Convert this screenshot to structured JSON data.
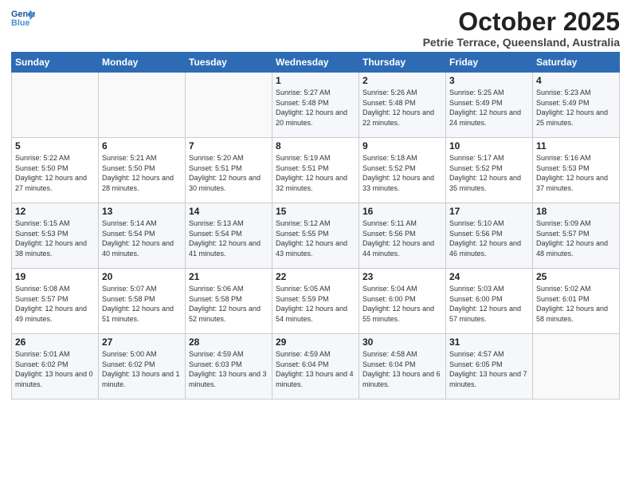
{
  "logo": {
    "line1": "General",
    "line2": "Blue"
  },
  "title": "October 2025",
  "subtitle": "Petrie Terrace, Queensland, Australia",
  "weekdays": [
    "Sunday",
    "Monday",
    "Tuesday",
    "Wednesday",
    "Thursday",
    "Friday",
    "Saturday"
  ],
  "weeks": [
    [
      {
        "day": "",
        "sunrise": "",
        "sunset": "",
        "daylight": ""
      },
      {
        "day": "",
        "sunrise": "",
        "sunset": "",
        "daylight": ""
      },
      {
        "day": "",
        "sunrise": "",
        "sunset": "",
        "daylight": ""
      },
      {
        "day": "1",
        "sunrise": "Sunrise: 5:27 AM",
        "sunset": "Sunset: 5:48 PM",
        "daylight": "Daylight: 12 hours and 20 minutes."
      },
      {
        "day": "2",
        "sunrise": "Sunrise: 5:26 AM",
        "sunset": "Sunset: 5:48 PM",
        "daylight": "Daylight: 12 hours and 22 minutes."
      },
      {
        "day": "3",
        "sunrise": "Sunrise: 5:25 AM",
        "sunset": "Sunset: 5:49 PM",
        "daylight": "Daylight: 12 hours and 24 minutes."
      },
      {
        "day": "4",
        "sunrise": "Sunrise: 5:23 AM",
        "sunset": "Sunset: 5:49 PM",
        "daylight": "Daylight: 12 hours and 25 minutes."
      }
    ],
    [
      {
        "day": "5",
        "sunrise": "Sunrise: 5:22 AM",
        "sunset": "Sunset: 5:50 PM",
        "daylight": "Daylight: 12 hours and 27 minutes."
      },
      {
        "day": "6",
        "sunrise": "Sunrise: 5:21 AM",
        "sunset": "Sunset: 5:50 PM",
        "daylight": "Daylight: 12 hours and 28 minutes."
      },
      {
        "day": "7",
        "sunrise": "Sunrise: 5:20 AM",
        "sunset": "Sunset: 5:51 PM",
        "daylight": "Daylight: 12 hours and 30 minutes."
      },
      {
        "day": "8",
        "sunrise": "Sunrise: 5:19 AM",
        "sunset": "Sunset: 5:51 PM",
        "daylight": "Daylight: 12 hours and 32 minutes."
      },
      {
        "day": "9",
        "sunrise": "Sunrise: 5:18 AM",
        "sunset": "Sunset: 5:52 PM",
        "daylight": "Daylight: 12 hours and 33 minutes."
      },
      {
        "day": "10",
        "sunrise": "Sunrise: 5:17 AM",
        "sunset": "Sunset: 5:52 PM",
        "daylight": "Daylight: 12 hours and 35 minutes."
      },
      {
        "day": "11",
        "sunrise": "Sunrise: 5:16 AM",
        "sunset": "Sunset: 5:53 PM",
        "daylight": "Daylight: 12 hours and 37 minutes."
      }
    ],
    [
      {
        "day": "12",
        "sunrise": "Sunrise: 5:15 AM",
        "sunset": "Sunset: 5:53 PM",
        "daylight": "Daylight: 12 hours and 38 minutes."
      },
      {
        "day": "13",
        "sunrise": "Sunrise: 5:14 AM",
        "sunset": "Sunset: 5:54 PM",
        "daylight": "Daylight: 12 hours and 40 minutes."
      },
      {
        "day": "14",
        "sunrise": "Sunrise: 5:13 AM",
        "sunset": "Sunset: 5:54 PM",
        "daylight": "Daylight: 12 hours and 41 minutes."
      },
      {
        "day": "15",
        "sunrise": "Sunrise: 5:12 AM",
        "sunset": "Sunset: 5:55 PM",
        "daylight": "Daylight: 12 hours and 43 minutes."
      },
      {
        "day": "16",
        "sunrise": "Sunrise: 5:11 AM",
        "sunset": "Sunset: 5:56 PM",
        "daylight": "Daylight: 12 hours and 44 minutes."
      },
      {
        "day": "17",
        "sunrise": "Sunrise: 5:10 AM",
        "sunset": "Sunset: 5:56 PM",
        "daylight": "Daylight: 12 hours and 46 minutes."
      },
      {
        "day": "18",
        "sunrise": "Sunrise: 5:09 AM",
        "sunset": "Sunset: 5:57 PM",
        "daylight": "Daylight: 12 hours and 48 minutes."
      }
    ],
    [
      {
        "day": "19",
        "sunrise": "Sunrise: 5:08 AM",
        "sunset": "Sunset: 5:57 PM",
        "daylight": "Daylight: 12 hours and 49 minutes."
      },
      {
        "day": "20",
        "sunrise": "Sunrise: 5:07 AM",
        "sunset": "Sunset: 5:58 PM",
        "daylight": "Daylight: 12 hours and 51 minutes."
      },
      {
        "day": "21",
        "sunrise": "Sunrise: 5:06 AM",
        "sunset": "Sunset: 5:58 PM",
        "daylight": "Daylight: 12 hours and 52 minutes."
      },
      {
        "day": "22",
        "sunrise": "Sunrise: 5:05 AM",
        "sunset": "Sunset: 5:59 PM",
        "daylight": "Daylight: 12 hours and 54 minutes."
      },
      {
        "day": "23",
        "sunrise": "Sunrise: 5:04 AM",
        "sunset": "Sunset: 6:00 PM",
        "daylight": "Daylight: 12 hours and 55 minutes."
      },
      {
        "day": "24",
        "sunrise": "Sunrise: 5:03 AM",
        "sunset": "Sunset: 6:00 PM",
        "daylight": "Daylight: 12 hours and 57 minutes."
      },
      {
        "day": "25",
        "sunrise": "Sunrise: 5:02 AM",
        "sunset": "Sunset: 6:01 PM",
        "daylight": "Daylight: 12 hours and 58 minutes."
      }
    ],
    [
      {
        "day": "26",
        "sunrise": "Sunrise: 5:01 AM",
        "sunset": "Sunset: 6:02 PM",
        "daylight": "Daylight: 13 hours and 0 minutes."
      },
      {
        "day": "27",
        "sunrise": "Sunrise: 5:00 AM",
        "sunset": "Sunset: 6:02 PM",
        "daylight": "Daylight: 13 hours and 1 minute."
      },
      {
        "day": "28",
        "sunrise": "Sunrise: 4:59 AM",
        "sunset": "Sunset: 6:03 PM",
        "daylight": "Daylight: 13 hours and 3 minutes."
      },
      {
        "day": "29",
        "sunrise": "Sunrise: 4:59 AM",
        "sunset": "Sunset: 6:04 PM",
        "daylight": "Daylight: 13 hours and 4 minutes."
      },
      {
        "day": "30",
        "sunrise": "Sunrise: 4:58 AM",
        "sunset": "Sunset: 6:04 PM",
        "daylight": "Daylight: 13 hours and 6 minutes."
      },
      {
        "day": "31",
        "sunrise": "Sunrise: 4:57 AM",
        "sunset": "Sunset: 6:05 PM",
        "daylight": "Daylight: 13 hours and 7 minutes."
      },
      {
        "day": "",
        "sunrise": "",
        "sunset": "",
        "daylight": ""
      }
    ]
  ]
}
